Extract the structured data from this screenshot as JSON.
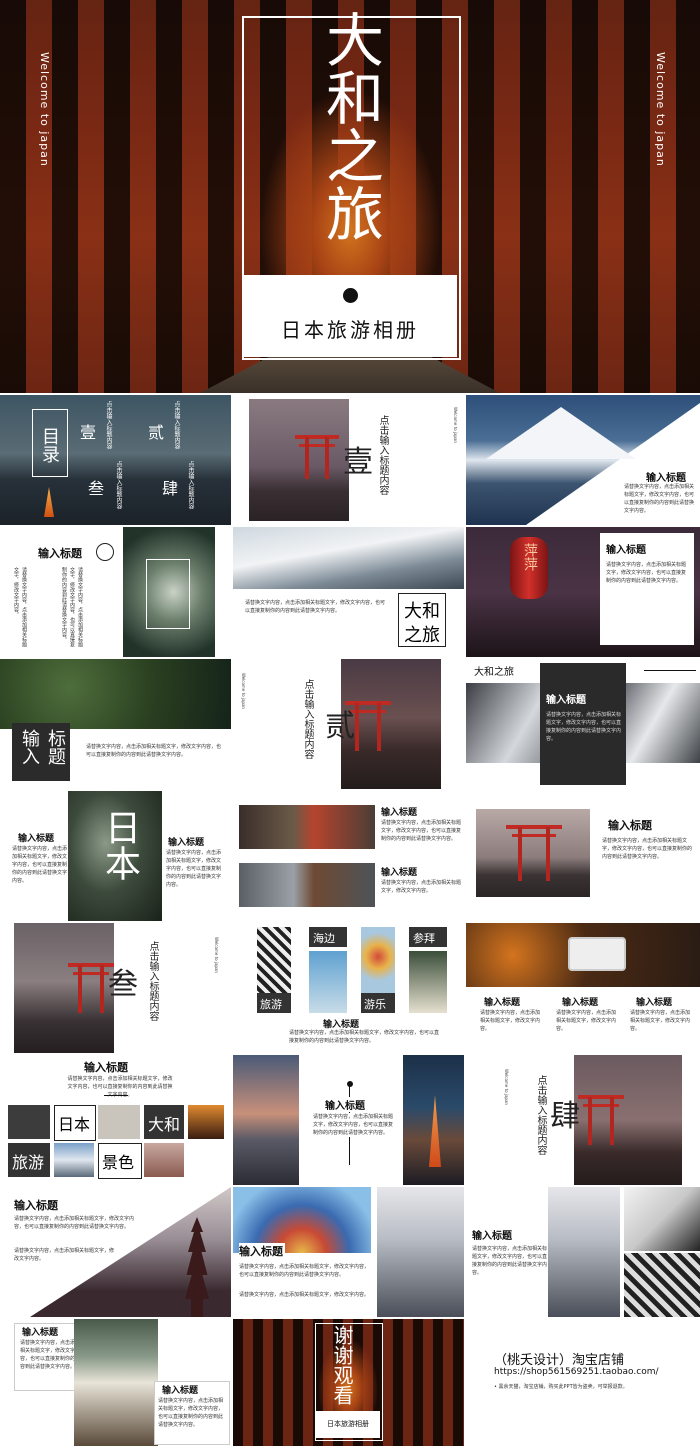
{
  "hero": {
    "welcome": "Welcome to japan",
    "title": "大和之旅",
    "subtitle": "日本旅游相册"
  },
  "toc": {
    "title": "目录",
    "nums": [
      "壹",
      "贰",
      "叁",
      "肆"
    ],
    "item": "点击输入标题内容"
  },
  "section_1": {
    "num": "壹",
    "text": "点击输入标题内容",
    "welcome": "Welcome to japan"
  },
  "section_2": {
    "num": "贰",
    "text": "点击输入标题内容",
    "welcome": "Welcome to japan"
  },
  "section_3": {
    "num": "叁",
    "text": "点击输入标题内容",
    "welcome": "Welcome to japan"
  },
  "section_4": {
    "num": "肆",
    "text": "点击输入标题内容",
    "welcome": "Welcome to japan"
  },
  "common": {
    "input_title": "输入标题",
    "body": "请替换文字内容，点击添加相关标题文字，修改文字内容，也可以直接复制你的内容到此请替换文字内容。",
    "body_short": "请替换文字内容，点击添加相关标题文字，修改文字内容。"
  },
  "slide_daiwa": {
    "line1": "大和",
    "line2": "之旅"
  },
  "slide_biaoti": {
    "chars": "标题输入"
  },
  "slide_dark": {
    "brand": "大和之旅"
  },
  "slide_nihon": {
    "word": "日本"
  },
  "slide_tags": {
    "t1": "海边",
    "t2": "参拜",
    "t3": "旅游",
    "t4": "游乐"
  },
  "slide_grid": {
    "a": "日本",
    "b": "大和",
    "c": "旅游",
    "d": "景色"
  },
  "lantern": {
    "text": "萍萍"
  },
  "thanks": {
    "title": "谢谢观看",
    "subtitle": "日本旅游相册"
  },
  "shop": {
    "name": "（桃夭设计）淘宝店铺",
    "url": "https://shop561569251.taobao.com/",
    "note": "• 黑余天猫，淘宝店铺，购买此PPT皆为盗卖，可举报退款。"
  }
}
